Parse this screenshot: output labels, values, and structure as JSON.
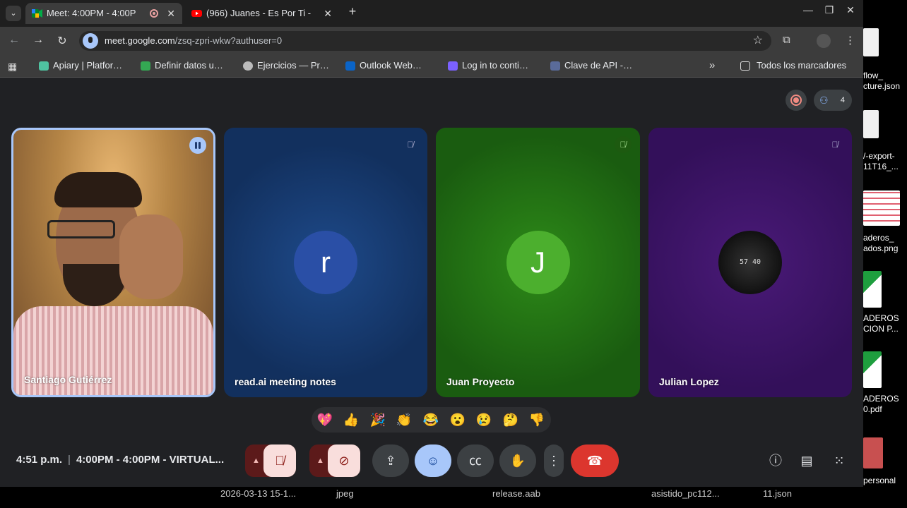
{
  "browser": {
    "tabs": [
      {
        "title": "Meet: 4:00PM - 4:00P",
        "active": true,
        "icon": "google-meet-icon"
      },
      {
        "title": "(966) Juanes - Es Por Ti -",
        "active": false,
        "icon": "youtube-icon"
      }
    ],
    "url": {
      "host": "meet.google.com",
      "path": "/zsq-zpri-wkw?authuser=0"
    },
    "bookmarks": [
      {
        "label": "Apiary | Platfor…",
        "color": "#4fc3a1"
      },
      {
        "label": "Definir datos u…",
        "color": "#34a853"
      },
      {
        "label": "Ejercicios — Pr…",
        "color": "#bbbbbb"
      },
      {
        "label": "Outlook Web…",
        "color": "#0a64c8"
      },
      {
        "label": "Log in to conti…",
        "color": "#7b61ff"
      },
      {
        "label": "Clave de API -…",
        "color": "#5a6b9a"
      }
    ],
    "all_bookmarks_label": "Todos los marcadores"
  },
  "meet": {
    "participant_count": "4",
    "participants": [
      {
        "name": "Santiago Gutiérrez",
        "speaking": true
      },
      {
        "name": "read.ai meeting notes",
        "initial": "r",
        "avatar_color": "#2a4fa6"
      },
      {
        "name": "Juan Proyecto",
        "initial": "J",
        "avatar_color": "#4caf2e"
      },
      {
        "name": "Julian Lopez"
      }
    ],
    "reactions": [
      "💖",
      "👍",
      "🎉",
      "👏",
      "😂",
      "😮",
      "😢",
      "🤔",
      "👎"
    ],
    "clock": "4:51 p.m.",
    "meeting_title": "4:00PM - 4:00PM - VIRTUAL..."
  },
  "desktop": {
    "icons": [
      {
        "label": "flow_\ncture.json"
      },
      {
        "label": "/-export-\n11T16_..."
      },
      {
        "label": "aderos_\nados.png"
      },
      {
        "label": "ADEROS\nCION P..."
      },
      {
        "label": "ADEROS\n0.pdf"
      },
      {
        "label": "personal"
      }
    ],
    "taskbar": [
      "2026-03-13 15-1...",
      "jpeg",
      "release.aab",
      "asistido_pc112...",
      "11.json"
    ]
  }
}
